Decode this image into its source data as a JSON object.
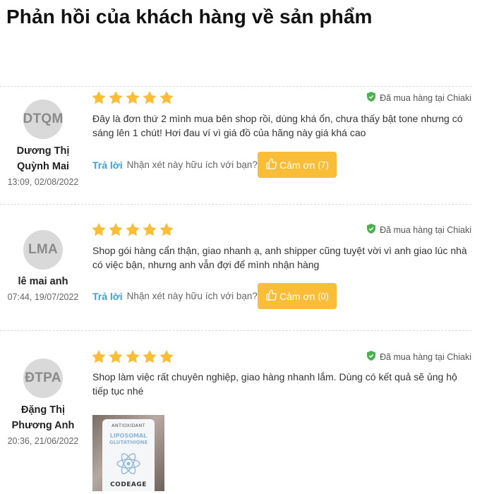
{
  "page": {
    "title": "Phản hồi của khách hàng về sản phẩm"
  },
  "colors": {
    "star": "#f9bd37",
    "verified_icon": "#4caf50",
    "reply_link": "#3aa0d8",
    "thanks_button": "#f9bd37",
    "avatar_bg": "#d9d9d9"
  },
  "reviews": [
    {
      "initials": "DTQM",
      "name": "Dương Thị Quỳnh Mai",
      "date": "13:09, 02/08/2022",
      "rating": 5,
      "verified": "Đã mua hàng tại Chiaki",
      "text": "Đây là đơn thứ 2 mình mua bên shop rồi, dùng khá ổn, chưa thấy bật tone nhưng có sáng lên 1 chút! Hơi đau ví vì giá đồ của hãng này giá khá cao",
      "reply_label": "Trả lời",
      "helpful_question": "Nhận xét này hữu ích với bạn?",
      "thanks_label": "Cảm ơn",
      "thanks_count": "(7)"
    },
    {
      "initials": "LMA",
      "name": "lê mai anh",
      "date": "07:44, 19/07/2022",
      "rating": 5,
      "verified": "Đã mua hàng tại Chiaki",
      "text": "Shop gói hàng cẩn thận, giao nhanh ạ, anh shipper cũng tuyệt vời vì anh giao lúc nhà có việc bận, nhưng anh vẫn đợi để mình nhận hàng",
      "reply_label": "Trả lời",
      "helpful_question": "Nhận xét này hữu ích với bạn?",
      "thanks_label": "Cảm ơn",
      "thanks_count": "(0)"
    },
    {
      "initials": "ĐTPA",
      "name": "Đặng Thị Phương Anh",
      "date": "20:36, 21/06/2022",
      "rating": 5,
      "verified": "Đã mua hàng tại Chiaki",
      "text": "Shop làm việc rất chuyên nghiệp, giao hàng nhanh lắm. Dùng có kết quả sẽ ủng hộ tiếp tục nhé",
      "photo": {
        "brand_line": "ANTIOXIDANT",
        "product_line_1": "LIPOSOMAL",
        "product_line_2": "GLUTATHIONE",
        "bottom_text": "CODEAGE"
      }
    }
  ]
}
